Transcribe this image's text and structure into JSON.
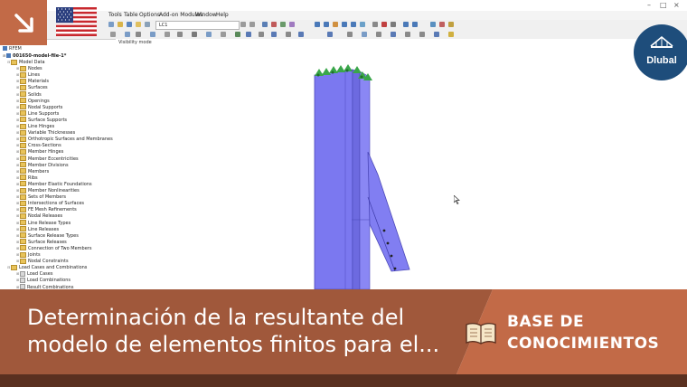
{
  "app": {
    "menu": [
      "Tools",
      "Table",
      "Options",
      "Add-on Modules",
      "Window",
      "Help"
    ],
    "load_case": "LC1",
    "window_controls": [
      "–",
      "□",
      "×"
    ]
  },
  "navigator": {
    "header": "RFEM",
    "project": "001650-model-file-1*",
    "items": [
      {
        "label": "Model Data",
        "level": 1,
        "type": "folder"
      },
      {
        "label": "Nodes",
        "level": 2,
        "type": "folder"
      },
      {
        "label": "Lines",
        "level": 2,
        "type": "folder"
      },
      {
        "label": "Materials",
        "level": 2,
        "type": "folder"
      },
      {
        "label": "Surfaces",
        "level": 2,
        "type": "folder"
      },
      {
        "label": "Solids",
        "level": 2,
        "type": "folder"
      },
      {
        "label": "Openings",
        "level": 2,
        "type": "folder"
      },
      {
        "label": "Nodal Supports",
        "level": 2,
        "type": "folder"
      },
      {
        "label": "Line Supports",
        "level": 2,
        "type": "folder"
      },
      {
        "label": "Surface Supports",
        "level": 2,
        "type": "folder"
      },
      {
        "label": "Line Hinges",
        "level": 2,
        "type": "folder"
      },
      {
        "label": "Variable Thicknesses",
        "level": 2,
        "type": "folder"
      },
      {
        "label": "Orthotropic Surfaces and Membranes",
        "level": 2,
        "type": "folder"
      },
      {
        "label": "Cross-Sections",
        "level": 2,
        "type": "folder"
      },
      {
        "label": "Member Hinges",
        "level": 2,
        "type": "folder"
      },
      {
        "label": "Member Eccentricities",
        "level": 2,
        "type": "folder"
      },
      {
        "label": "Member Divisions",
        "level": 2,
        "type": "folder"
      },
      {
        "label": "Members",
        "level": 2,
        "type": "folder"
      },
      {
        "label": "Ribs",
        "level": 2,
        "type": "folder"
      },
      {
        "label": "Member Elastic Foundations",
        "level": 2,
        "type": "folder"
      },
      {
        "label": "Member Nonlinearities",
        "level": 2,
        "type": "folder"
      },
      {
        "label": "Sets of Members",
        "level": 2,
        "type": "folder"
      },
      {
        "label": "Intersections of Surfaces",
        "level": 2,
        "type": "folder"
      },
      {
        "label": "FE Mesh Refinements",
        "level": 2,
        "type": "folder"
      },
      {
        "label": "Nodal Releases",
        "level": 2,
        "type": "folder"
      },
      {
        "label": "Line Release Types",
        "level": 2,
        "type": "folder"
      },
      {
        "label": "Line Releases",
        "level": 2,
        "type": "folder"
      },
      {
        "label": "Surface Release Types",
        "level": 2,
        "type": "folder"
      },
      {
        "label": "Surface Releases",
        "level": 2,
        "type": "folder"
      },
      {
        "label": "Connection of Two Members",
        "level": 2,
        "type": "folder"
      },
      {
        "label": "Joints",
        "level": 2,
        "type": "folder"
      },
      {
        "label": "Nodal Constraints",
        "level": 2,
        "type": "folder"
      },
      {
        "label": "Load Cases and Combinations",
        "level": 1,
        "type": "folder"
      },
      {
        "label": "Load Cases",
        "level": 2,
        "type": "file"
      },
      {
        "label": "Load Combinations",
        "level": 2,
        "type": "file"
      },
      {
        "label": "Result Combinations",
        "level": 2,
        "type": "file"
      }
    ]
  },
  "viewport": {
    "mode_label": "Visibility mode"
  },
  "banner": {
    "title": "Determinación de la resultante del modelo de elementos finitos para el...",
    "category": "BASE DE CONOCIMIENTOS"
  },
  "brand": {
    "logo_text": "Dlubal"
  },
  "colors": {
    "accent_orange": "#c26a47",
    "banner_dark": "#a0583b",
    "logo_blue": "#1e4d7b",
    "column_blue": "#7b78f0",
    "support_green": "#3aa64a"
  }
}
